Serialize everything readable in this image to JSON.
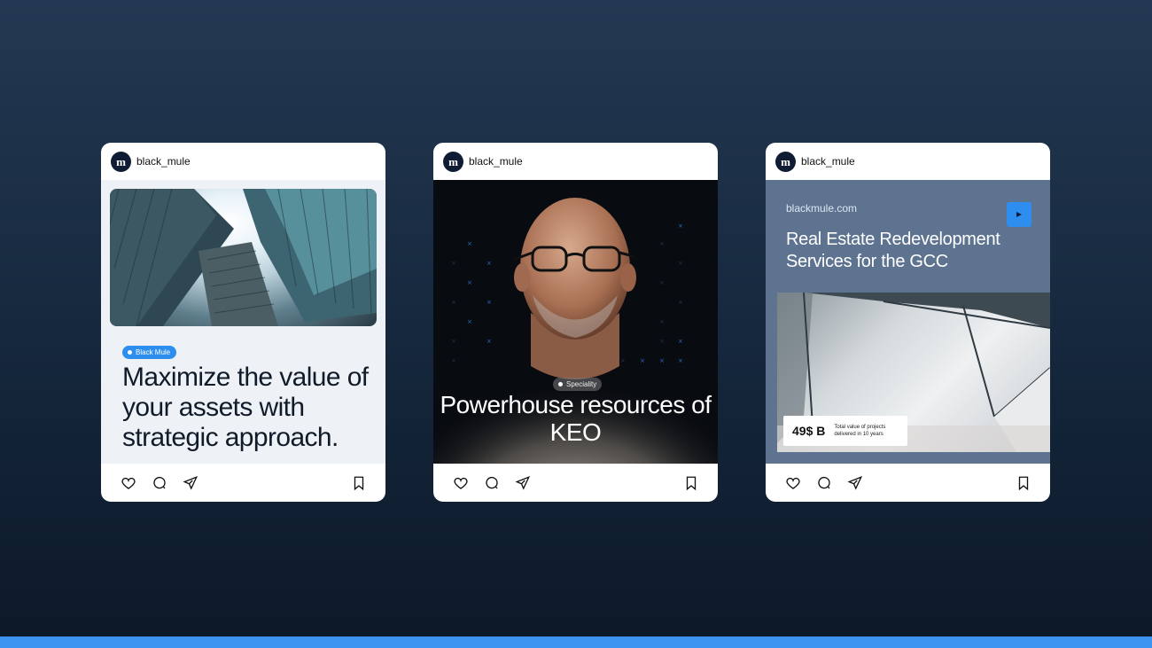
{
  "posts": [
    {
      "username": "black_mule",
      "avatar_glyph": "m",
      "tag": "Black Mule",
      "headline": "Maximize the value of your assets with strategic approach.",
      "photo": "glass-skyscrapers-photo"
    },
    {
      "username": "black_mule",
      "avatar_glyph": "m",
      "tag": "Speciality",
      "headline": "Powerhouse resources of KEO",
      "photo": "bald-man-with-glasses-portrait"
    },
    {
      "username": "black_mule",
      "avatar_glyph": "m",
      "domain": "blackmule.com",
      "headline": "Real Estate Redevelopment Services for the GCC",
      "stat_value": "49$ B",
      "stat_label": "Total value of projects delivered in 10 years",
      "photo": "architectural-panel-photo"
    }
  ],
  "actions": {
    "icons": [
      "heart-icon",
      "comment-icon",
      "share-icon",
      "bookmark-icon"
    ]
  },
  "colors": {
    "accent": "#2d8ef0",
    "background_top": "#233852",
    "background_bottom": "#0c1828",
    "card": "#ffffff",
    "card3_media": "#5d7390"
  }
}
